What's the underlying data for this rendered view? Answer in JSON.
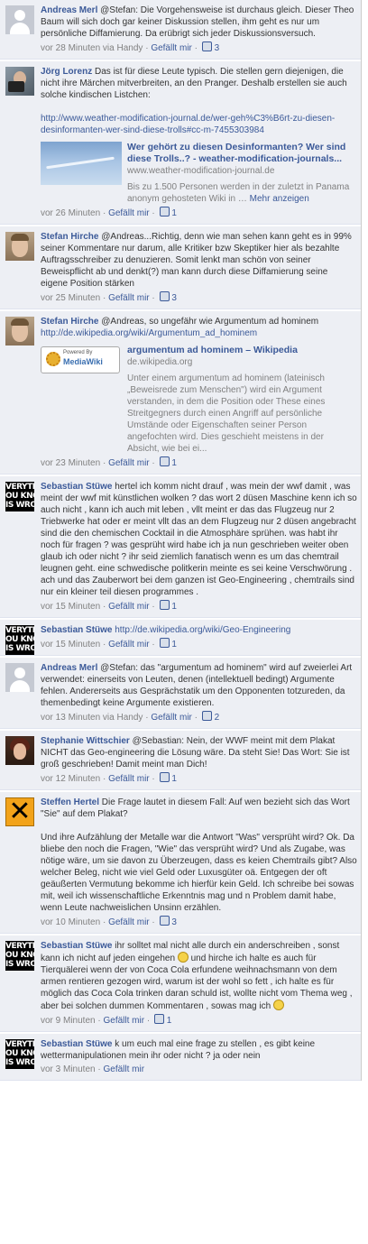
{
  "comments": [
    {
      "author": "Andreas Merl",
      "text": "@Stefan: Die Vorgehensweise ist durchaus gleich. Dieser Theo Baum will sich doch gar keiner Diskussion stellen, ihm geht es nur um persönliche Diffamierung. Da erübrigt sich jeder Diskussionsversuch.",
      "time": "vor 28 Minuten via Handy",
      "like": "Gefällt mir",
      "likes": "3"
    },
    {
      "author": "Jörg Lorenz",
      "text": "Das ist für diese Leute typisch. Die stellen gern diejenigen, die nicht ihre Märchen mitverbreiten, an den Pranger. Deshalb erstellen sie auch solche kindischen Listchen:",
      "url": "http://www.weather-modification-journal.de/wer-geh%C3%B6rt-zu-diesen-desinformanten-wer-sind-diese-trolls#cc-m-7455303984",
      "attachment": {
        "title": "Wer gehört zu diesen Desinformanten? Wer sind diese Trolls..? - weather-modification-journals...",
        "domain": "www.weather-modification-journal.de",
        "desc": "Bis zu 1.500 Personen werden in der zuletzt in Panama anonym gehosteten Wiki in",
        "more": "Mehr anzeigen"
      },
      "time": "vor 26 Minuten",
      "like": "Gefällt mir",
      "likes": "1"
    },
    {
      "author": "Stefan Hirche",
      "text": "@Andreas...Richtig, denn wie man sehen kann geht es in 99% seiner Kommentare nur darum, alle Kritiker bzw Skeptiker hier als bezahlte Auftragsschreiber zu denuzieren. Somit lenkt man schön von seiner Beweispflicht ab und denkt(?) man kann durch diese Diffamierung seine eigene Position stärken",
      "time": "vor 25 Minuten",
      "like": "Gefällt mir",
      "likes": "3"
    },
    {
      "author": "Stefan Hirche",
      "text": "@Andreas, so ungefähr wie Argumentum ad hominem",
      "url": "http://de.wikipedia.org/wiki/Argumentum_ad_hominem",
      "attachment": {
        "badge_top": "Powered By",
        "badge_name": "MediaWiki",
        "title": "argumentum ad hominem – Wikipedia",
        "domain": "de.wikipedia.org",
        "desc": "Unter einem argumentum ad hominem (lateinisch „Beweisrede zum Menschen\") wird ein Argument verstanden, in dem die Position oder These eines Streitgegners durch einen Angriff auf persönliche Umstände oder Eigenschaften seiner Person angefochten wird. Dies geschieht meistens in der Absicht, wie bei ei..."
      },
      "time": "vor 23 Minuten",
      "like": "Gefällt mir",
      "likes": "1"
    },
    {
      "author": "Sebastian Stüwe",
      "text": "hertel ich komm nicht drauf , was mein der wwf damit , was meint der wwf mit künstlichen wolken ? das wort 2 düsen Maschine kenn ich so auch nicht , kann ich auch mit leben , vllt meint er das das Flugzeug nur 2 Triebwerke hat oder er meint vllt das an dem Flugzeug nur 2 düsen angebracht sind die den chemischen Cocktail in die Atmosphäre sprühen. was habt ihr noch für fragen ? was gesprüht wird habe ich ja nun geschrieben weiter oben glaub ich oder nicht ? ihr seid ziemlich fanatisch wenn es um das chemtrail leugnen geht. eine schwedische politkerin meinte es sei keine Verschwörung . ach und das Zauberwort bei dem ganzen ist Geo-Engineering , chemtrails sind nur ein kleiner teil diesen programmes .",
      "time": "vor 15 Minuten",
      "like": "Gefällt mir",
      "likes": "1"
    },
    {
      "author": "Sebastian Stüwe",
      "url": "http://de.wikipedia.org/wiki/Geo-Engineering",
      "time": "vor 15 Minuten",
      "like": "Gefällt mir",
      "likes": "1"
    },
    {
      "author": "Andreas Merl",
      "text": "@Stefan: das \"argumentum ad hominem\" wird auf zweierlei Art verwendet: einerseits von Leuten, denen (intellektuell bedingt) Argumente fehlen. Andererseits aus Gesprächstatik um den Opponenten totzureden, da themenbedingt keine Argumente existieren.",
      "time": "vor 13 Minuten via Handy",
      "like": "Gefällt mir",
      "likes": "2"
    },
    {
      "author": "Stephanie Wittschier",
      "text": "@Sebastian: Nein, der WWF meint mit dem Plakat NICHT das Geo-engineering die Lösung wäre. Da steht Sie! Das Wort: Sie ist groß geschrieben! Damit meint man Dich!",
      "time": "vor 12 Minuten",
      "like": "Gefällt mir",
      "likes": "1"
    },
    {
      "author": "Steffen Hertel",
      "text": "Die Frage lautet in diesem Fall: Auf wen bezieht sich das Wort \"Sie\" auf dem Plakat?",
      "text2": "Und ihre Aufzählung der Metalle war die Antwort \"Was\" versprüht wird? Ok. Da bliebe den noch die Fragen, \"Wie\" das versprüht wird? Und als Zugabe, was nötige wäre, um sie davon zu Überzeugen, dass es keien Chemtrails gibt? Also welcher Beleg, nicht wie viel Geld oder Luxusgüter oä. Entgegen der oft geäußerten Vermutung bekomme ich hierfür kein Geld. Ich schreibe bei sowas mit, weil ich wissenschaftliche Erkenntnis mag und n Problem damit habe, wenn Leute nachweislichen Unsinn erzählen.",
      "time": "vor 10 Minuten",
      "like": "Gefällt mir",
      "likes": "3"
    },
    {
      "author": "Sebastian Stüwe",
      "text": "ihr solltet mal nicht alle durch ein anderschreiben , sonst kann ich nicht auf jeden eingehen",
      "text_b": "und hirche ich halte es auch für Tierquälerei wenn der von Coca Cola erfundene weihnachsmann von dem armen rentieren gezogen wird, warum ist der wohl so fett , ich halte es für möglich das Coca Cola trinken daran schuld ist, wollte nicht vom Thema weg , aber bei solchen dummen Kommentaren , sowas mag ich",
      "time": "vor 9 Minuten",
      "like": "Gefällt mir",
      "likes": "1"
    },
    {
      "author": "Sebastian Stüwe",
      "text": "k um euch mal eine frage zu stellen , es gibt keine wettermanipulationen mein ihr oder nicht ? ja oder nein",
      "time": "vor 3 Minuten",
      "like": "Gefällt mir"
    }
  ],
  "avatar_text": [
    "VERYTHIN",
    "OU KNOW",
    "IS WRON"
  ],
  "colors": {
    "link": "#3b5998",
    "meta": "#808080",
    "bg": "#edeff4"
  }
}
